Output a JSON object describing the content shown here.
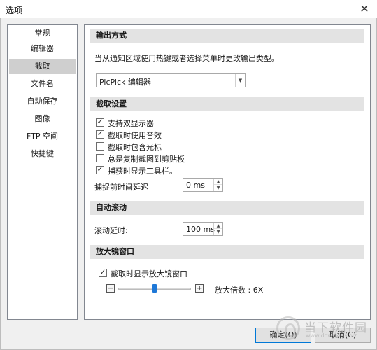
{
  "window": {
    "title": "选项",
    "close_glyph": "✕"
  },
  "sidebar": {
    "items": [
      {
        "label": "常规"
      },
      {
        "label": "编辑器"
      },
      {
        "label": "截取",
        "selected": true
      },
      {
        "label": "文件名"
      },
      {
        "label": "自动保存"
      },
      {
        "label": "图像"
      },
      {
        "label": "FTP 空间"
      },
      {
        "label": "快捷键"
      }
    ]
  },
  "output": {
    "header": "输出方式",
    "description": "当从通知区域使用热键或者选择菜单时更改输出类型。",
    "dropdown_value": "PicPick 编辑器"
  },
  "capture": {
    "header": "截取设置",
    "options": [
      {
        "label": "支持双显示器",
        "checked": true
      },
      {
        "label": "截取时使用音效",
        "checked": true
      },
      {
        "label": "截取时包含光标",
        "checked": false
      },
      {
        "label": "总是复制截图到剪贴板",
        "checked": false
      },
      {
        "label": "捕获时显示工具栏。",
        "checked": true
      }
    ],
    "delay_label": "捕捉前时间延迟",
    "delay_value": "0 ms"
  },
  "autoscroll": {
    "header": "自动滚动",
    "delay_label": "滚动延时:",
    "delay_value": "100 ms"
  },
  "magnifier": {
    "header": "放大镜窗口",
    "show_label": "截取时显示放大镜窗口",
    "show_checked": true,
    "minus_glyph": "−",
    "plus_glyph": "+",
    "zoom_text": "放大倍数 : 6X",
    "slider_position": 0.5
  },
  "buttons": {
    "ok": "确定(O)",
    "cancel": "取消(C)"
  },
  "watermark": {
    "text": "当下软件园",
    "sub": "www.downxia.com"
  },
  "colors": {
    "accent": "#0078d7",
    "slider_thumb": "#1e78d7",
    "section_bg": "#e3e3e3",
    "selected_bg": "#cfcfcf"
  },
  "icons": {
    "close": "close-icon",
    "dropdown": "chevron-down-icon",
    "check": "check-icon"
  }
}
